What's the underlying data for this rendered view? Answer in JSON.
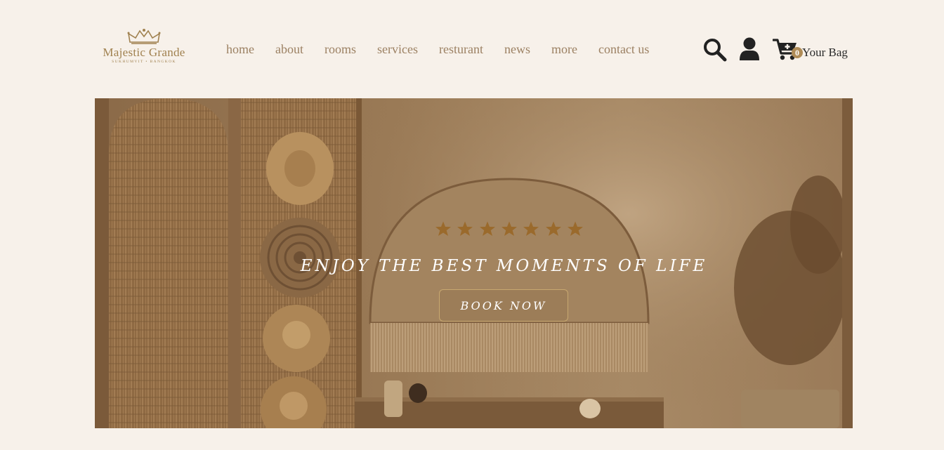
{
  "logo": {
    "title": "Majestic Grande",
    "subtitle": "SUKHUMVIT • BANGKOK"
  },
  "nav": {
    "items": [
      {
        "label": "home"
      },
      {
        "label": "about"
      },
      {
        "label": "rooms"
      },
      {
        "label": "services"
      },
      {
        "label": "resturant"
      },
      {
        "label": "news"
      },
      {
        "label": "more"
      },
      {
        "label": "contact us"
      }
    ]
  },
  "tools": {
    "search_icon": "search-icon",
    "user_icon": "user-icon",
    "cart_icon": "cart-plus-icon",
    "bag_count": "0",
    "bag_label": "Your Bag"
  },
  "hero": {
    "rating": 7,
    "tagline": "ENJOY THE BEST MOMENTS OF LIFE",
    "cta_label": "BOOK NOW"
  },
  "colors": {
    "background": "#f7f1ea",
    "brand_gold": "#a0814f",
    "nav_text": "#9c8163",
    "star": "#9a6a2c",
    "icon_dark": "#222222"
  }
}
